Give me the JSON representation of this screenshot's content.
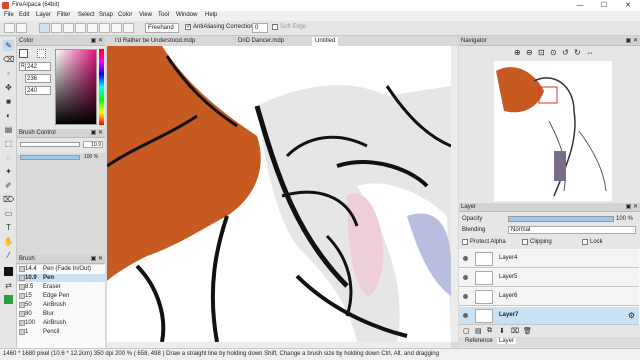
{
  "window": {
    "title": "FireAlpaca (64bit)",
    "minimize": "—",
    "maximize": "☐",
    "close": "✕"
  },
  "menu": [
    "File",
    "Edit",
    "Layer",
    "Filter",
    "Select",
    "Snap",
    "Color",
    "View",
    "Tool",
    "Window",
    "Help"
  ],
  "toolbar": {
    "mode": "Freehand",
    "antialias_label": "AntiAliasing",
    "antialias_checked": "✓",
    "correction_label": "Correction",
    "correction_value": "0",
    "softedge_label": "Soft Edge"
  },
  "color_panel": {
    "title": "Color",
    "r": "242",
    "g": "236",
    "b": "240"
  },
  "brush_control": {
    "title": "Brush Control",
    "size": "10.9",
    "opacity": "100 %"
  },
  "brush_panel": {
    "title": "Brush",
    "items": [
      {
        "size": "14.4",
        "name": "Pen (Fade In/Out)"
      },
      {
        "size": "10.9",
        "name": "Pen"
      },
      {
        "size": "8.5",
        "name": "Eraser"
      },
      {
        "size": "15",
        "name": "Edge Pen"
      },
      {
        "size": "50",
        "name": "AirBrush"
      },
      {
        "size": "80",
        "name": "Blur"
      },
      {
        "size": "100",
        "name": "AirBrush"
      },
      {
        "size": "1",
        "name": "Pencil"
      }
    ]
  },
  "tabs": [
    "I'd Rather be Understood.mdp",
    "DnD Dancer.mdp",
    "Untitled"
  ],
  "navigator": {
    "title": "Navigator"
  },
  "layer_panel": {
    "title": "Layer",
    "opacity_label": "Opacity",
    "opacity_value": "100 %",
    "blending_label": "Blending",
    "blending_value": "Normal",
    "protect_alpha": "Protect Alpha",
    "clipping": "Clipping",
    "lock": "Lock",
    "layers": [
      "Layer4",
      "Layer5",
      "Layer6",
      "Layer7"
    ],
    "tabs": [
      "Reference",
      "Layer"
    ]
  },
  "status": "1460 * 1680 pixel  (10.6 * 12.2cm)  350 dpi  200 %  ( 658, 498 )  Draw a straight line by holding down Shift, Change a brush size by holding down Ctrl, Alt, and dragging"
}
